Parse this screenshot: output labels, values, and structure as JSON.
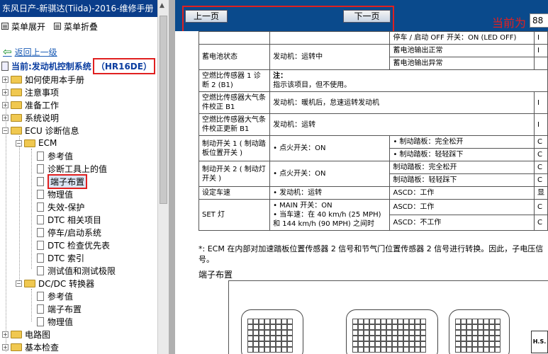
{
  "window": {
    "title": "东风日产-新骐达(Tiida)-2016-维修手册"
  },
  "menu": {
    "expand": "菜单展开",
    "collapse": "菜单折叠"
  },
  "nav": {
    "back": "返回上一级",
    "current": "当前:发动机控制系统",
    "current_code": "（HR16DE）"
  },
  "tree": {
    "how": "如何使用本手册",
    "notice": "注意事项",
    "prep": "准备工作",
    "sys": "系统说明",
    "ecu": "ECU 诊断信息",
    "ecm": "ECM",
    "ref": "参考值",
    "diagval": "诊断工具上的值",
    "term": "端子布置",
    "phys": "物理值",
    "fail": "失效-保护",
    "dtc": "DTC 相关项目",
    "ss": "停车/启动系统",
    "dtcpri": "DTC 检查优先表",
    "dtcidx": "DTC 索引",
    "test": "测试值和测试极限",
    "dcdc": "DC/DC 转换器",
    "dc_ref": "参考值",
    "dc_term": "端子布置",
    "dc_phys": "物理值",
    "circuit": "电路图",
    "basic": "基本检查"
  },
  "toolbar": {
    "prev": "上一页",
    "next": "下一页",
    "current_label": "当前为",
    "page": "88"
  },
  "table": {
    "r0": {
      "a": "",
      "b": "",
      "c": "停车 / 启动 OFF 开关：ON (LED OFF)",
      "d": "I"
    },
    "r1": {
      "a": "蓄电池状态",
      "b": "发动机：运转中",
      "c1": "蓄电池输出正常",
      "c2": "蓄电池输出异常",
      "d": "I"
    },
    "r2": {
      "a": "空燃比传感器 1 诊断 2 (B1)",
      "b1": "注：",
      "b2": "指示该项目，但不使用。"
    },
    "r3": {
      "a": "空燃比传感器大气条件校正 B1",
      "b": "发动机：暖机后，怠速运转发动机",
      "d": "I"
    },
    "r4": {
      "a": "空燃比传感器大气条件校正更新 B1",
      "b": "发动机：运转",
      "d": "I"
    },
    "r5": {
      "a": "制动开关 1 ( 制动踏板位置开关 )",
      "b": "• 点火开关：ON",
      "c1": "• 制动踏板：完全松开",
      "c2": "• 制动踏板：轻轻踩下",
      "d1": "C",
      "d2": "C"
    },
    "r6": {
      "a": "制动开关 2 ( 制动灯开关 )",
      "b": "• 点火开关：ON",
      "c1": "制动踏板：完全松开",
      "c2": "制动踏板：轻轻踩下",
      "d1": "C",
      "d2": "C"
    },
    "r7": {
      "a": "设定车速",
      "b": "• 发动机：运转",
      "c": "ASCD：工作",
      "d": "显"
    },
    "r8": {
      "a": "SET 灯",
      "b1": "• MAIN 开关：ON",
      "b2": "• 当车速：在 40 km/h (25 MPH) 和 144 km/h (90 MPH) 之间时",
      "c1": "ASCD：工作",
      "c2": "ASCD：不工作",
      "d1": "C",
      "d2": "C"
    }
  },
  "note": "*: ECM 在内部对加速踏板位置传感器 2 信号和节气门位置传感器 2 信号进行转换。因此，子电压信号。",
  "terminal_title": "端子布置",
  "badge": "H.S."
}
